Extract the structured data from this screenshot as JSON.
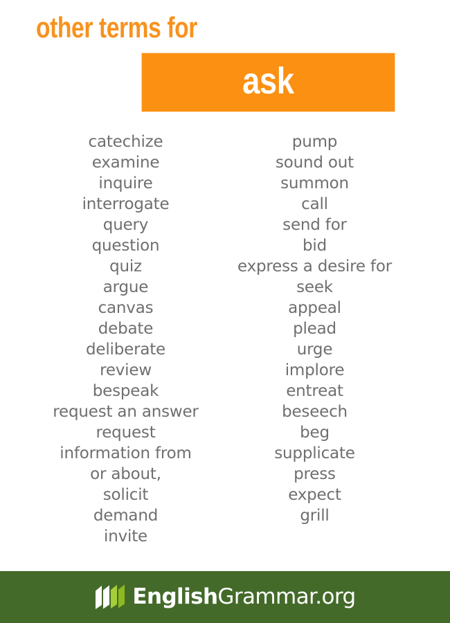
{
  "header": {
    "title": "other terms for",
    "term": "ask",
    "title_color": "#F7921E",
    "box_color": "#FB9012",
    "term_color": "#FFFFFF"
  },
  "word_list": {
    "text_color": "#6F6F6F",
    "left_column": [
      "catechize",
      "examine",
      "inquire",
      "interrogate",
      "query",
      "question",
      "quiz",
      "argue",
      "canvas",
      "debate",
      "deliberate",
      "review",
      "bespeak",
      "request an answer",
      "request",
      "information from",
      "or about,",
      "solicit",
      "demand",
      "invite"
    ],
    "right_column": [
      "pump",
      "sound out",
      "summon",
      "call",
      "send for",
      "bid",
      "express a desire for",
      "seek",
      "appeal",
      "plead",
      "urge",
      "implore",
      "entreat",
      "beseech",
      "beg",
      "supplicate",
      "press",
      "expect",
      "grill"
    ]
  },
  "footer": {
    "background_color": "#446A2A",
    "logo_icon": "open-book-icon",
    "logo_name_bold": "English",
    "logo_name_light": "Grammar.org"
  }
}
